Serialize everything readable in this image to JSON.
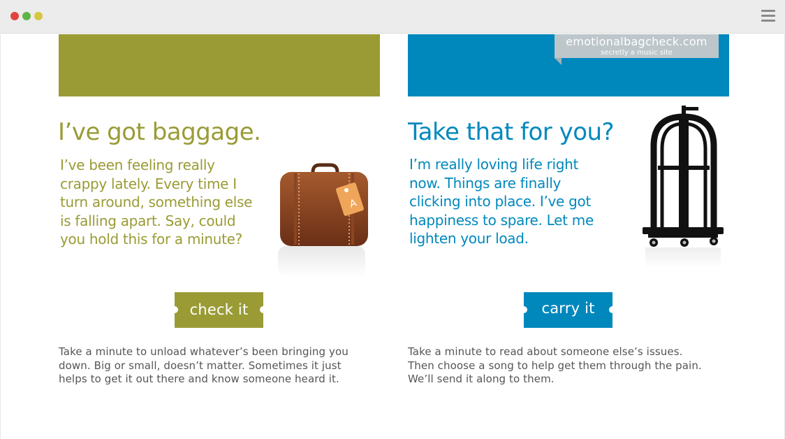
{
  "window": {
    "controls": [
      "close",
      "minimize",
      "zoom"
    ],
    "menu_icon": "hamburger-menu-icon"
  },
  "logo": {
    "name": "emotionalbagcheck.com",
    "tagline": "secretly a music site"
  },
  "left": {
    "heading": "I’ve got baggage.",
    "body_lines": [
      "I’ve been feeling really",
      "crappy lately. Every time I",
      "turn around, something else",
      "is falling apart. Say, could",
      "you hold this for a minute?"
    ],
    "button_label": "check it",
    "description_lines": [
      "Take a minute to unload whatever’s been bringing you",
      "down. Big or small, doesn’t matter. Sometimes it just",
      "helps to get it out there and know someone heard it."
    ],
    "image_icon": "suitcase-icon",
    "color": "#9a9b35"
  },
  "right": {
    "heading": "Take that for you?",
    "body_lines": [
      "I’m really loving life right",
      "now. Things are finally",
      "clicking into place. I’ve got",
      "happiness to spare. Let me",
      "lighten your load."
    ],
    "button_label": "carry it",
    "description_lines": [
      "Take a minute to read about someone else’s issues.",
      "Then choose a song to help get them through the pain.",
      "We’ll send it along to them."
    ],
    "image_icon": "luggage-cart-icon",
    "color": "#0088bd"
  }
}
